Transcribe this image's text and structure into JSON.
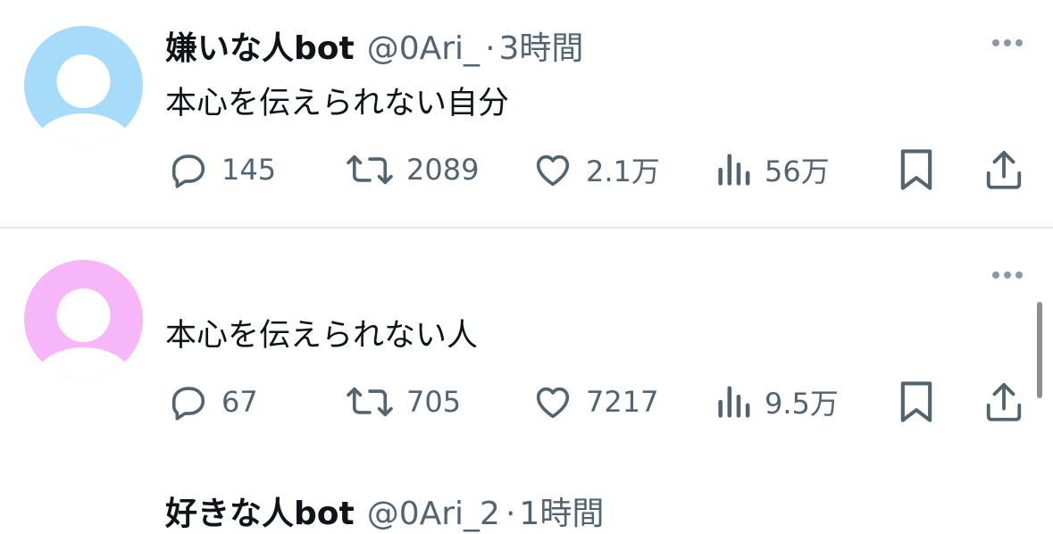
{
  "tweets": [
    {
      "display_name": "嫌いな人bot",
      "handle": "@0Ari_",
      "separator": "·",
      "time": "3時間",
      "text": "本心を伝えられない自分",
      "avatar_color": "#a6dcfa",
      "metrics": {
        "replies": "145",
        "retweets": "2089",
        "likes": "2.1万",
        "views": "56万"
      }
    },
    {
      "display_name": "好きな人bot",
      "handle": "@0Ari_2",
      "separator": "·",
      "time": "1時間",
      "text": "本心を伝えられない人",
      "avatar_color": "#f7b6f7",
      "metrics": {
        "replies": "67",
        "retweets": "705",
        "likes": "7217",
        "views": "9.5万"
      }
    }
  ],
  "icons": {
    "reply": "reply-icon",
    "retweet": "retweet-icon",
    "like": "heart-icon",
    "views": "views-icon",
    "bookmark": "bookmark-icon",
    "share": "share-icon",
    "more": "more-icon"
  },
  "colors": {
    "text_primary": "#0f1419",
    "text_secondary": "#536471",
    "divider": "#e6e9ec"
  }
}
